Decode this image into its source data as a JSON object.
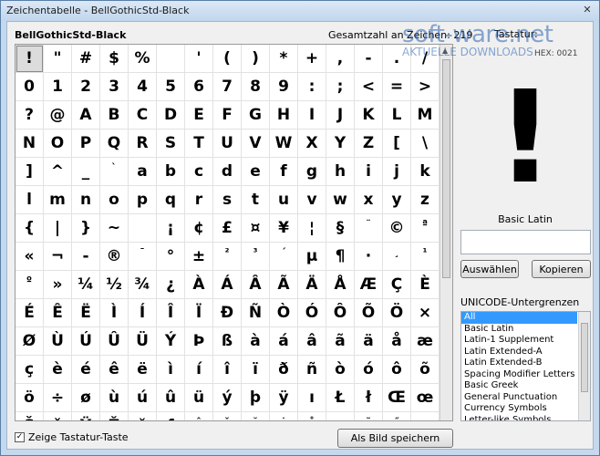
{
  "window": {
    "title": "Zeichentabelle - BellGothicStd-Black",
    "close_icon": "✕"
  },
  "header": {
    "font_name": "BellGothicStd-Black",
    "total_label": "Gesamtzahl an Zeichen: 219",
    "tastatur_label": "Tastatur:",
    "hex_label": "HEX: 0021"
  },
  "preview": {
    "glyph": "!",
    "block_name": "Basic Latin"
  },
  "char_input": {
    "value": ""
  },
  "buttons": {
    "select": "Auswählen",
    "copy": "Kopieren",
    "save": "Als Bild speichern"
  },
  "ranges": {
    "label": "UNICODE-Untergrenzen",
    "items": [
      "All",
      "Basic Latin",
      "Latin-1 Supplement",
      "Latin Extended-A",
      "Latin Extended-B",
      "Spacing Modifier Letters",
      "Basic Greek",
      "General Punctuation",
      "Currency Symbols",
      "Letter-like Symbols"
    ],
    "selected_index": 0
  },
  "checkbox": {
    "label": "Zeige Tastatur-Taste",
    "checked": true,
    "mark": "✓"
  },
  "watermark": {
    "logo": "soft-ware.net",
    "sub": "AKTUELLE DOWNLOADS"
  },
  "grid": {
    "selected_index": 0,
    "cells": [
      "!",
      "\"",
      "#",
      "$",
      "%",
      "",
      "'",
      "(",
      ")",
      "*",
      "+",
      ",",
      "-",
      ".",
      "/",
      "0",
      "1",
      "2",
      "3",
      "4",
      "5",
      "6",
      "7",
      "8",
      "9",
      ":",
      ";",
      "<",
      "=",
      ">",
      "?",
      "@",
      "A",
      "B",
      "C",
      "D",
      "E",
      "F",
      "G",
      "H",
      "I",
      "J",
      "K",
      "L",
      "M",
      "N",
      "O",
      "P",
      "Q",
      "R",
      "S",
      "T",
      "U",
      "V",
      "W",
      "X",
      "Y",
      "Z",
      "[",
      "\\",
      "]",
      "^",
      "_",
      "`",
      "a",
      "b",
      "c",
      "d",
      "e",
      "f",
      "g",
      "h",
      "i",
      "j",
      "k",
      "l",
      "m",
      "n",
      "o",
      "p",
      "q",
      "r",
      "s",
      "t",
      "u",
      "v",
      "w",
      "x",
      "y",
      "z",
      "{",
      "|",
      "}",
      "~",
      "",
      "¡",
      "¢",
      "£",
      "¤",
      "¥",
      "¦",
      "§",
      "¨",
      "©",
      "ª",
      "«",
      "¬",
      "-",
      "®",
      "¯",
      "°",
      "±",
      "²",
      "³",
      "´",
      "µ",
      "¶",
      "·",
      "¸",
      "¹",
      "º",
      "»",
      "¼",
      "½",
      "¾",
      "¿",
      "À",
      "Á",
      "Â",
      "Ã",
      "Ä",
      "Å",
      "Æ",
      "Ç",
      "È",
      "É",
      "Ê",
      "Ë",
      "Ì",
      "Í",
      "Î",
      "Ï",
      "Ð",
      "Ñ",
      "Ò",
      "Ó",
      "Ô",
      "Õ",
      "Ö",
      "×",
      "Ø",
      "Ù",
      "Ú",
      "Û",
      "Ü",
      "Ý",
      "Þ",
      "ß",
      "à",
      "á",
      "â",
      "ã",
      "ä",
      "å",
      "æ",
      "ç",
      "è",
      "é",
      "ê",
      "ë",
      "ì",
      "í",
      "î",
      "ï",
      "ð",
      "ñ",
      "ò",
      "ó",
      "ô",
      "õ",
      "ö",
      "÷",
      "ø",
      "ù",
      "ú",
      "û",
      "ü",
      "ý",
      "þ",
      "ÿ",
      "ı",
      "Ł",
      "ł",
      "Œ",
      "œ",
      "Š",
      "š",
      "Ÿ",
      "Ž",
      "ž",
      "ƒ",
      "ˆ",
      "ˇ",
      "˘",
      "˙",
      "˚",
      "˛",
      "˜",
      "˝",
      "–"
    ]
  }
}
